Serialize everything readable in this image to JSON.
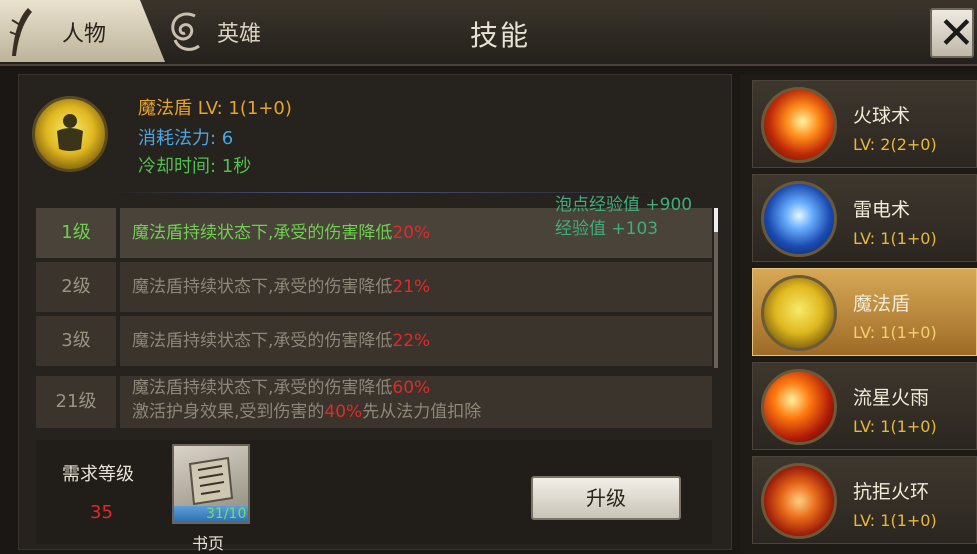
{
  "tabs": {
    "people": "人物",
    "hero": "英雄"
  },
  "title": "技能",
  "skill_detail": {
    "name_line": "魔法盾 LV: 1(1+0)",
    "mana_line": "消耗法力: 6",
    "cooldown_line": "冷却时间: 1秒"
  },
  "exp_popup": {
    "bubble_exp": "泡点经验值 +900",
    "exp": "经验值 +103"
  },
  "levels": [
    {
      "level": "1级",
      "desc": "魔法盾持续状态下,承受的伤害降低",
      "value": "20%",
      "active": true
    },
    {
      "level": "2级",
      "desc": "魔法盾持续状态下,承受的伤害降低",
      "value": "21%",
      "active": false
    },
    {
      "level": "3级",
      "desc": "魔法盾持续状态下,承受的伤害降低",
      "value": "22%",
      "active": false
    }
  ],
  "level21": {
    "level": "21级",
    "line1_text": "魔法盾持续状态下,承受的伤害降低",
    "line1_value": "60%",
    "line2_text_a": "激活护身效果,受到伤害的",
    "line2_value": "40%",
    "line2_text_b": "先从法力值扣除"
  },
  "requirement": {
    "label": "需求等级",
    "value": "35"
  },
  "item": {
    "count": "31/10",
    "name": "书页"
  },
  "upgrade_label": "升级",
  "skills": [
    {
      "name": "火球术",
      "lv": "LV: 2(2+0)",
      "icon": "fireball-icon"
    },
    {
      "name": "雷电术",
      "lv": "LV: 1(1+0)",
      "icon": "thunder-icon"
    },
    {
      "name": "魔法盾",
      "lv": "LV: 1(1+0)",
      "icon": "magic-shield-icon"
    },
    {
      "name": "流星火雨",
      "lv": "LV: 1(1+0)",
      "icon": "meteor-rain-icon"
    },
    {
      "name": "抗拒火环",
      "lv": "LV: 1(1+0)",
      "icon": "repel-fire-ring-icon"
    }
  ],
  "selected_skill": "魔法盾",
  "colors": {
    "green": "#6fd04f",
    "red": "#e02a2a",
    "orange": "#e6a32e",
    "blue": "#4aa6e6"
  }
}
